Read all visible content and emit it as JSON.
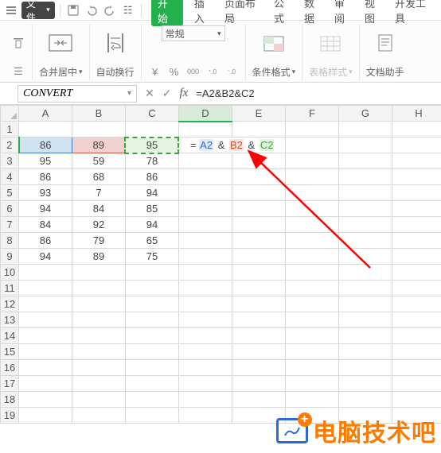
{
  "menubar": {
    "file_label": "文件"
  },
  "tabs": {
    "items": [
      "开始",
      "插入",
      "页面布局",
      "公式",
      "数据",
      "审阅",
      "视图",
      "开发工具"
    ],
    "active_index": 0
  },
  "ribbon": {
    "merge_label": "合并居中",
    "wrap_label": "自动换行",
    "number_format": "常规",
    "cond_fmt_label": "条件格式",
    "table_style_label": "表格样式",
    "doc_helper_label": "文档助手",
    "currency_symbol": "¥",
    "percent_symbol": "%",
    "thousands_symbol": "000",
    "inc_dec_a": ".0→.00",
    "inc_dec_b": ".00→.0"
  },
  "namebox": {
    "value": "CONVERT"
  },
  "formula_bar": {
    "value": "=A2&B2&C2"
  },
  "grid": {
    "col_headers": [
      "A",
      "B",
      "C",
      "D",
      "E",
      "F",
      "G",
      "H"
    ],
    "row_headers": [
      "1",
      "2",
      "3",
      "4",
      "5",
      "6",
      "7",
      "8",
      "9",
      "10",
      "11",
      "12",
      "13",
      "14",
      "15",
      "16",
      "17",
      "18",
      "19"
    ],
    "active_col": "D",
    "active_row": "2",
    "formula_cell": {
      "eq": "=",
      "ref_a": "A2",
      "ref_b": "B2",
      "ref_c": "C2",
      "amp": "&"
    },
    "data": [
      {
        "a": "86",
        "b": "89",
        "c": "95"
      },
      {
        "a": "95",
        "b": "59",
        "c": "78"
      },
      {
        "a": "86",
        "b": "68",
        "c": "86"
      },
      {
        "a": "93",
        "b": "7",
        "c": "94"
      },
      {
        "a": "94",
        "b": "84",
        "c": "85"
      },
      {
        "a": "84",
        "b": "92",
        "c": "94"
      },
      {
        "a": "86",
        "b": "79",
        "c": "65"
      },
      {
        "a": "94",
        "b": "89",
        "c": "75"
      }
    ]
  },
  "watermark": {
    "text": "电脑技术吧"
  },
  "colors": {
    "accent": "#22b14c",
    "ref_blue": "#2a6bd6",
    "ref_red": "#c8502a",
    "ref_green": "#3aa63a",
    "arrow": "#ff0000",
    "brand": "#ff7a00"
  }
}
